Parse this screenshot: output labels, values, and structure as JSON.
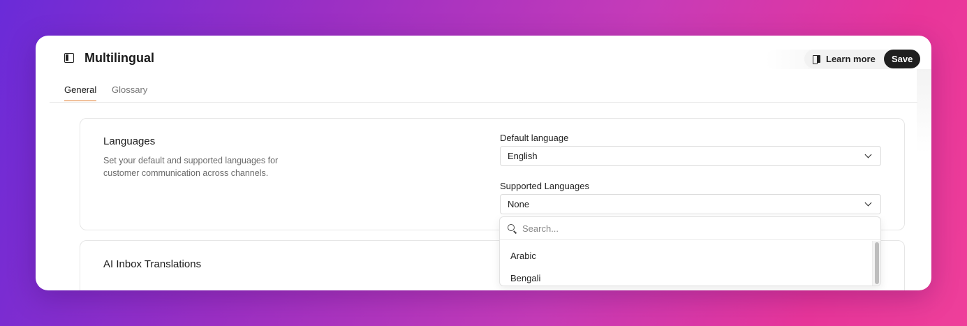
{
  "header": {
    "title": "Multilingual",
    "learn_more_label": "Learn more",
    "save_label": "Save"
  },
  "tabs": [
    {
      "label": "General",
      "active": true
    },
    {
      "label": "Glossary",
      "active": false
    }
  ],
  "languages_card": {
    "title": "Languages",
    "description": "Set your default and supported languages for customer communication across channels.",
    "default_language_label": "Default language",
    "default_language_value": "English",
    "supported_languages_label": "Supported Languages",
    "supported_languages_value": "None"
  },
  "dropdown": {
    "search_placeholder": "Search...",
    "options": [
      "Arabic",
      "Bengali"
    ]
  },
  "ai_card": {
    "title": "AI Inbox Translations"
  },
  "colors": {
    "accent_tab_underline": "#e07a2a",
    "save_button_bg": "#1f1f1f"
  }
}
